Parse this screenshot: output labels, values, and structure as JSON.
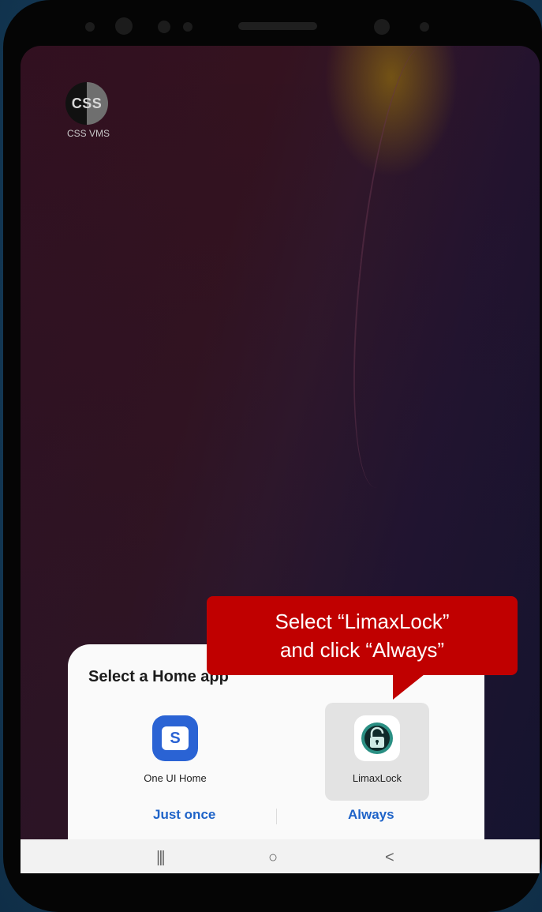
{
  "homescreen": {
    "app_icon_text": "CSS",
    "app_label": "CSS VMS"
  },
  "dialog": {
    "title": "Select a Home app",
    "options": [
      {
        "label": "One UI Home",
        "icon": "one-ui-home-icon",
        "selected": false
      },
      {
        "label": "LimaxLock",
        "icon": "padlock-icon",
        "selected": true
      }
    ],
    "just_once": "Just once",
    "always": "Always"
  },
  "navbar": {
    "recents": "|||",
    "home": "○",
    "back": "<"
  },
  "callout": {
    "line1": "Select “LimaxLock”",
    "line2": "and click “Always”"
  },
  "colors": {
    "accent": "#1e63c8",
    "callout": "#c00000",
    "oneui": "#2a63d4",
    "lock": "#1f8f86"
  }
}
